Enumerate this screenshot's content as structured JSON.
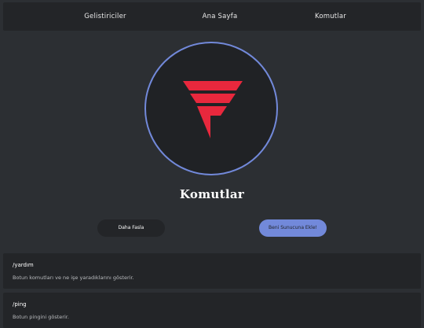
{
  "nav": {
    "developers": "Gelistiriciler",
    "home": "Ana Sayfa",
    "commands": "Komutlar"
  },
  "logo": {
    "icon": "red-f-logo-icon",
    "accent": "#e8283d",
    "ring": "#7289da"
  },
  "page_title": "Komutlar",
  "buttons": {
    "more": "Daha Fasla",
    "add": "Beni Sunucuna Ekle!"
  },
  "commands": [
    {
      "name": "/yardım",
      "description": "Botun komutları ve ne işe yaradıklarını gösterir."
    },
    {
      "name": "/ping",
      "description": "Botun pingini gösterir."
    }
  ],
  "colors": {
    "background": "#2c2f33",
    "card": "#232528",
    "accent": "#7289da"
  }
}
